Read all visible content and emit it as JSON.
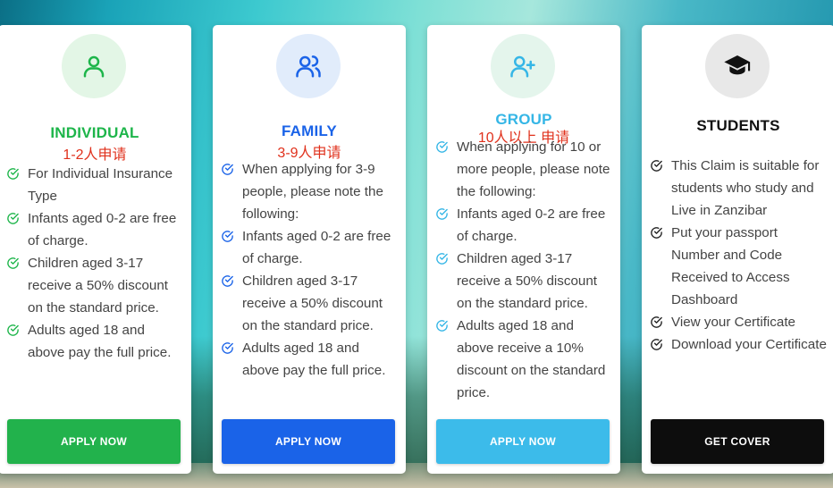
{
  "cards": [
    {
      "title": "INDIVIDUAL",
      "subtitle": "1-2人申请",
      "icon": "person-icon",
      "accent": "#1db54a",
      "icon_bg": "#e3f6e6",
      "features": [
        "For Individual Insurance Type",
        "Infants aged 0-2 are free of charge.",
        "Children aged 3-17 receive a 50% discount on the standard price.",
        "Adults aged 18 and above pay the full price."
      ],
      "button_label": "APPLY NOW",
      "button_color": "#22b24c"
    },
    {
      "title": "FAMILY",
      "subtitle": "3-9人申请",
      "icon": "users-icon",
      "accent": "#1a63e8",
      "icon_bg": "#e1ecfb",
      "features": [
        "When applying for 3-9 people, please note the following:",
        "Infants aged 0-2 are free of charge.",
        "Children aged 3-17 receive a 50% discount on the standard price.",
        "Adults aged 18 and above pay the full price."
      ],
      "button_label": "APPLY NOW",
      "button_color": "#1a63e8"
    },
    {
      "title": "GROUP",
      "subtitle": "10人以上 申请",
      "icon": "user-plus-icon",
      "accent": "#35b6e6",
      "icon_bg": "#e4f5ec",
      "features": [
        "When applying for 10 or more people, please note the following:",
        "Infants aged 0-2 are free of charge.",
        "Children aged 3-17 receive a 50% discount on the standard price.",
        "Adults aged 18 and above receive a 10% discount on the standard price."
      ],
      "button_label": "APPLY NOW",
      "button_color": "#3cbbea"
    },
    {
      "title": "STUDENTS",
      "subtitle": "",
      "icon": "graduation-cap-icon",
      "accent": "#111111",
      "icon_bg": "#e8e8e8",
      "features": [
        "This Claim is suitable for students who study and Live in Zanzibar",
        "Put your passport Number and Code Received to Access Dashboard",
        "View your Certificate",
        "Download your Certificate"
      ],
      "button_label": "GET COVER",
      "button_color": "#0d0d0d"
    }
  ]
}
